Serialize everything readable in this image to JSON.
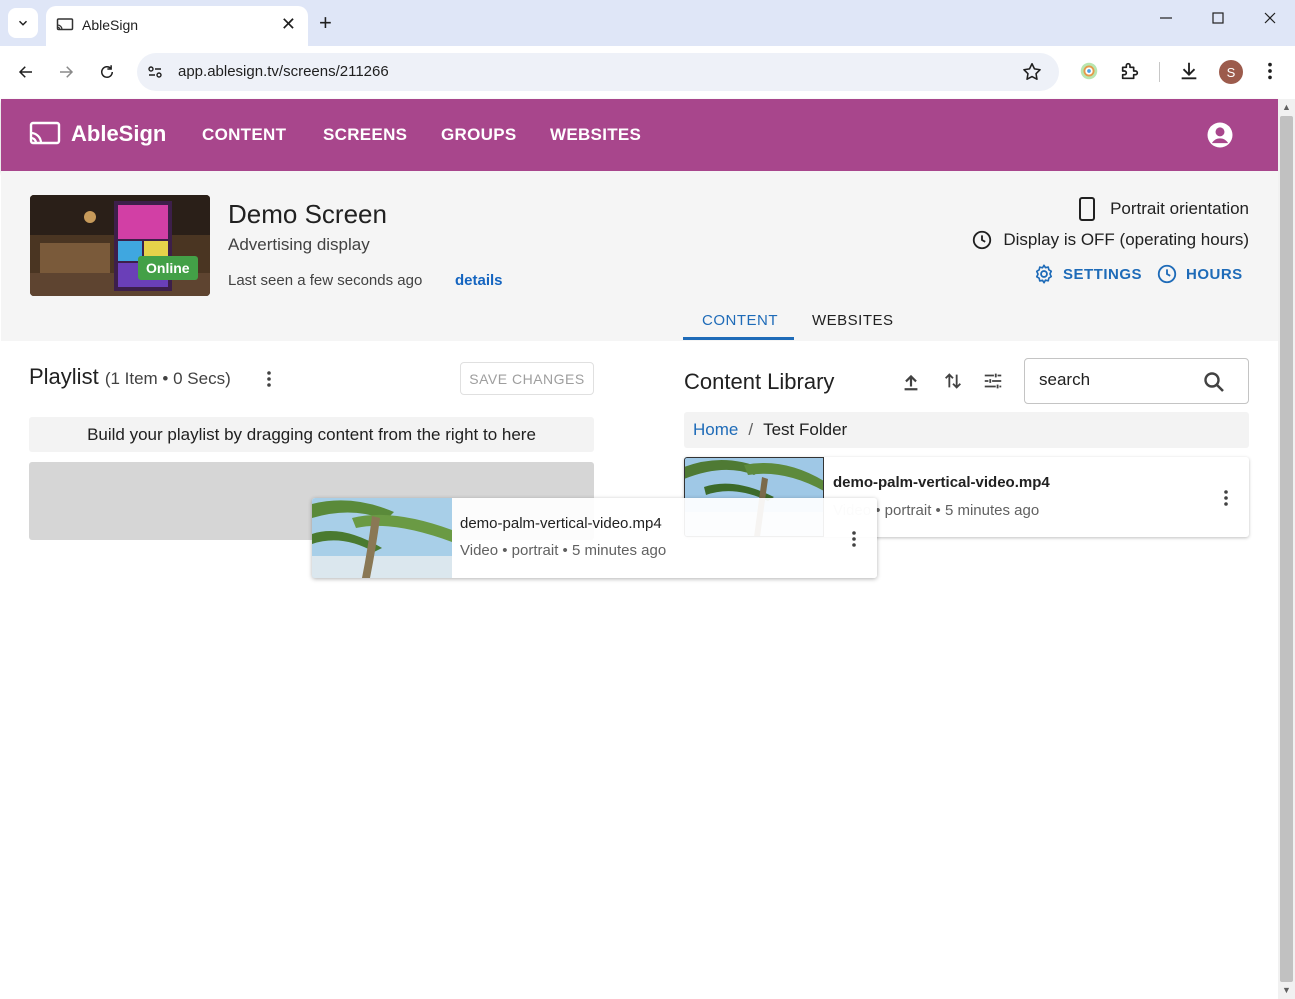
{
  "browser": {
    "tab_title": "AbleSign",
    "url": "app.ablesign.tv/screens/211266",
    "profile_initial": "S",
    "close_glyph": "✕",
    "new_tab_glyph": "+"
  },
  "app": {
    "brand": "AbleSign",
    "nav": [
      "CONTENT",
      "SCREENS",
      "GROUPS",
      "WEBSITES"
    ],
    "brand_color": "#a8468c",
    "accent_color": "#1e6bb8"
  },
  "screen": {
    "title": "Demo Screen",
    "subtitle": "Advertising display",
    "status": "Online",
    "last_seen": "Last seen a few seconds ago",
    "details_link": "details",
    "orientation": "Portrait orientation",
    "display_status": "Display is OFF (operating hours)",
    "settings_label": "SETTINGS",
    "hours_label": "HOURS",
    "tabs": [
      "CONTENT",
      "WEBSITES"
    ],
    "active_tab": "CONTENT"
  },
  "playlist": {
    "title": "Playlist",
    "meta": "(1 Item • 0 Secs)",
    "save_label": "SAVE CHANGES",
    "hint": "Build your playlist by dragging content from the right to here"
  },
  "library": {
    "title": "Content Library",
    "search_placeholder": "search",
    "breadcrumb": {
      "home": "Home",
      "separator": "/",
      "current": "Test Folder"
    },
    "items": [
      {
        "name": "demo-palm-vertical-video.mp4",
        "type": "Video",
        "meta": "• portrait • 5 minutes ago"
      }
    ],
    "dragging": {
      "name": "demo-palm-vertical-video.mp4",
      "meta": "Video • portrait • 5 minutes ago"
    }
  }
}
